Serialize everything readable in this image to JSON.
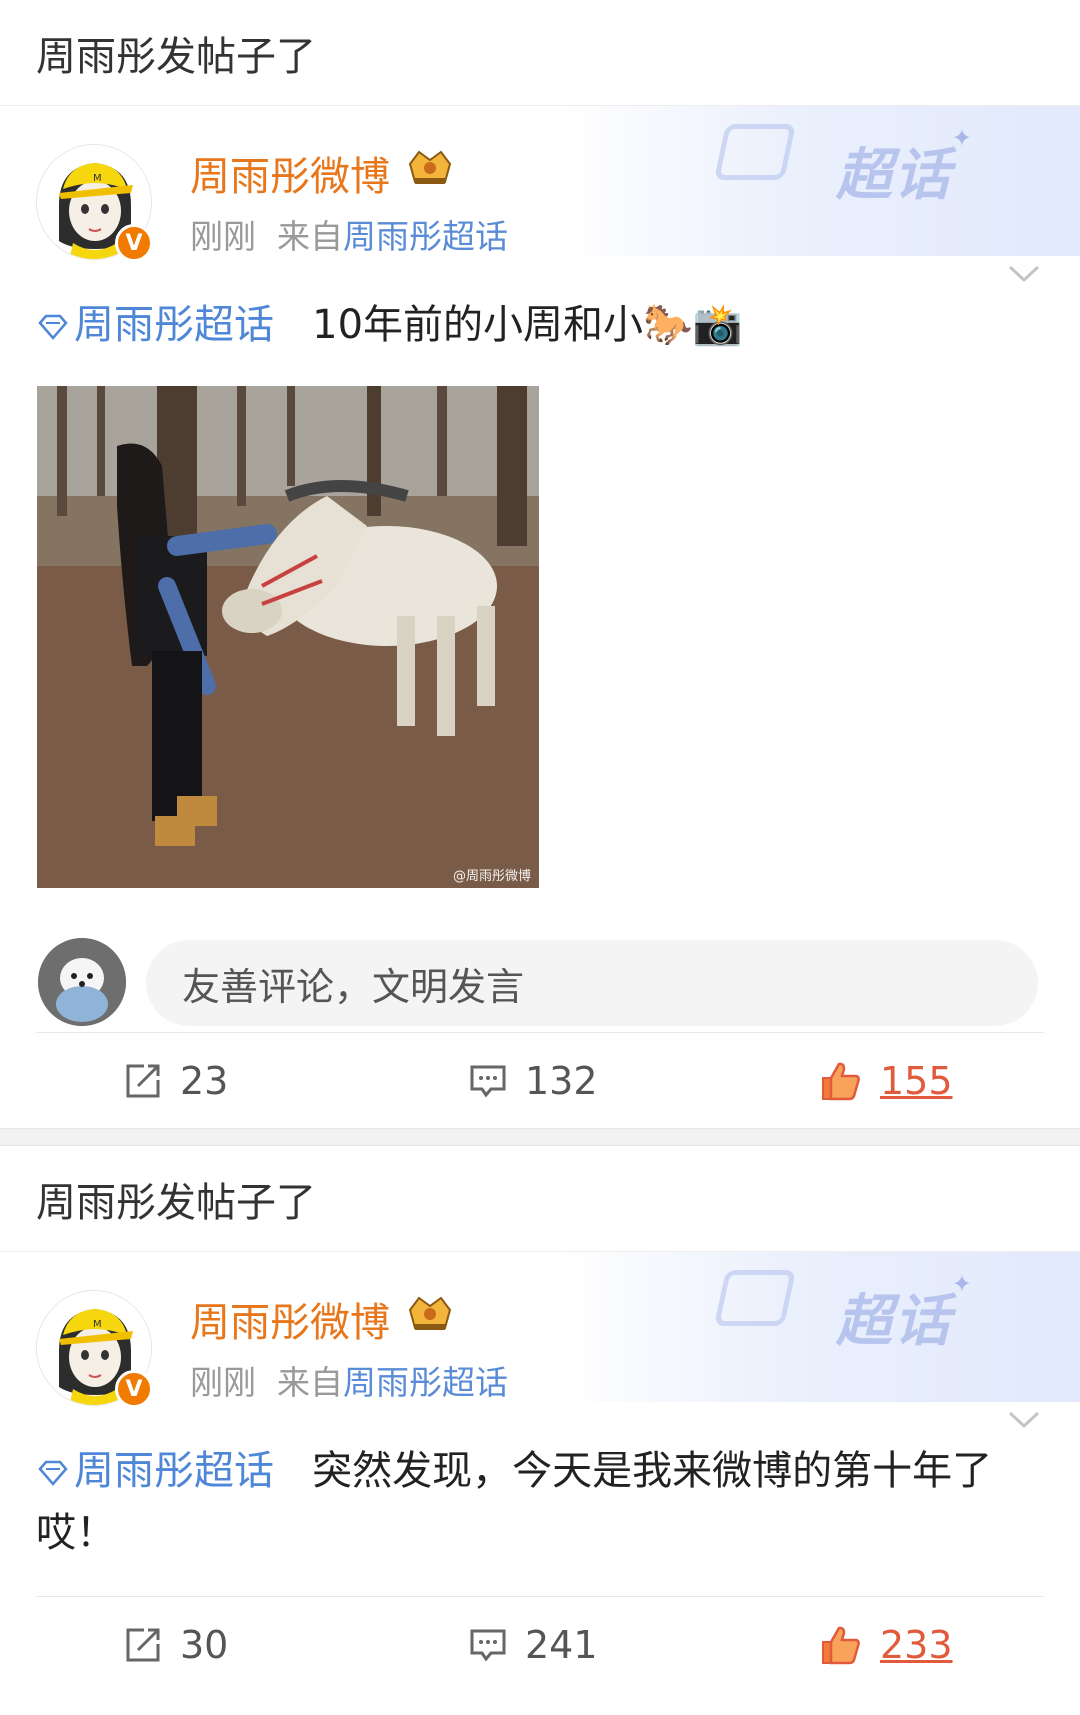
{
  "section1": {
    "title": "周雨彤发帖子了"
  },
  "post1": {
    "user_name": "周雨彤微博",
    "time": "刚刚",
    "from_label": "来自",
    "source": "周雨彤超话",
    "topic": "周雨彤超话",
    "text": "10年前的小周和小🐎📸",
    "badge_text": "超话",
    "photo_watermark": "@周雨彤微博",
    "comment_placeholder": "友善评论，文明发言",
    "reposts": "23",
    "comments": "132",
    "likes": "155"
  },
  "section2": {
    "title": "周雨彤发帖子了"
  },
  "post2": {
    "user_name": "周雨彤微博",
    "time": "刚刚",
    "from_label": "来自",
    "source": "周雨彤超话",
    "topic": "周雨彤超话",
    "text": "突然发现，今天是我来微博的第十年了哎！",
    "badge_text": "超话",
    "reposts": "30",
    "comments": "241",
    "likes": "233"
  },
  "colors": {
    "username": "#e8761a",
    "link": "#4f87d8",
    "like": "#e25a3c",
    "verified": "#f07b00"
  }
}
